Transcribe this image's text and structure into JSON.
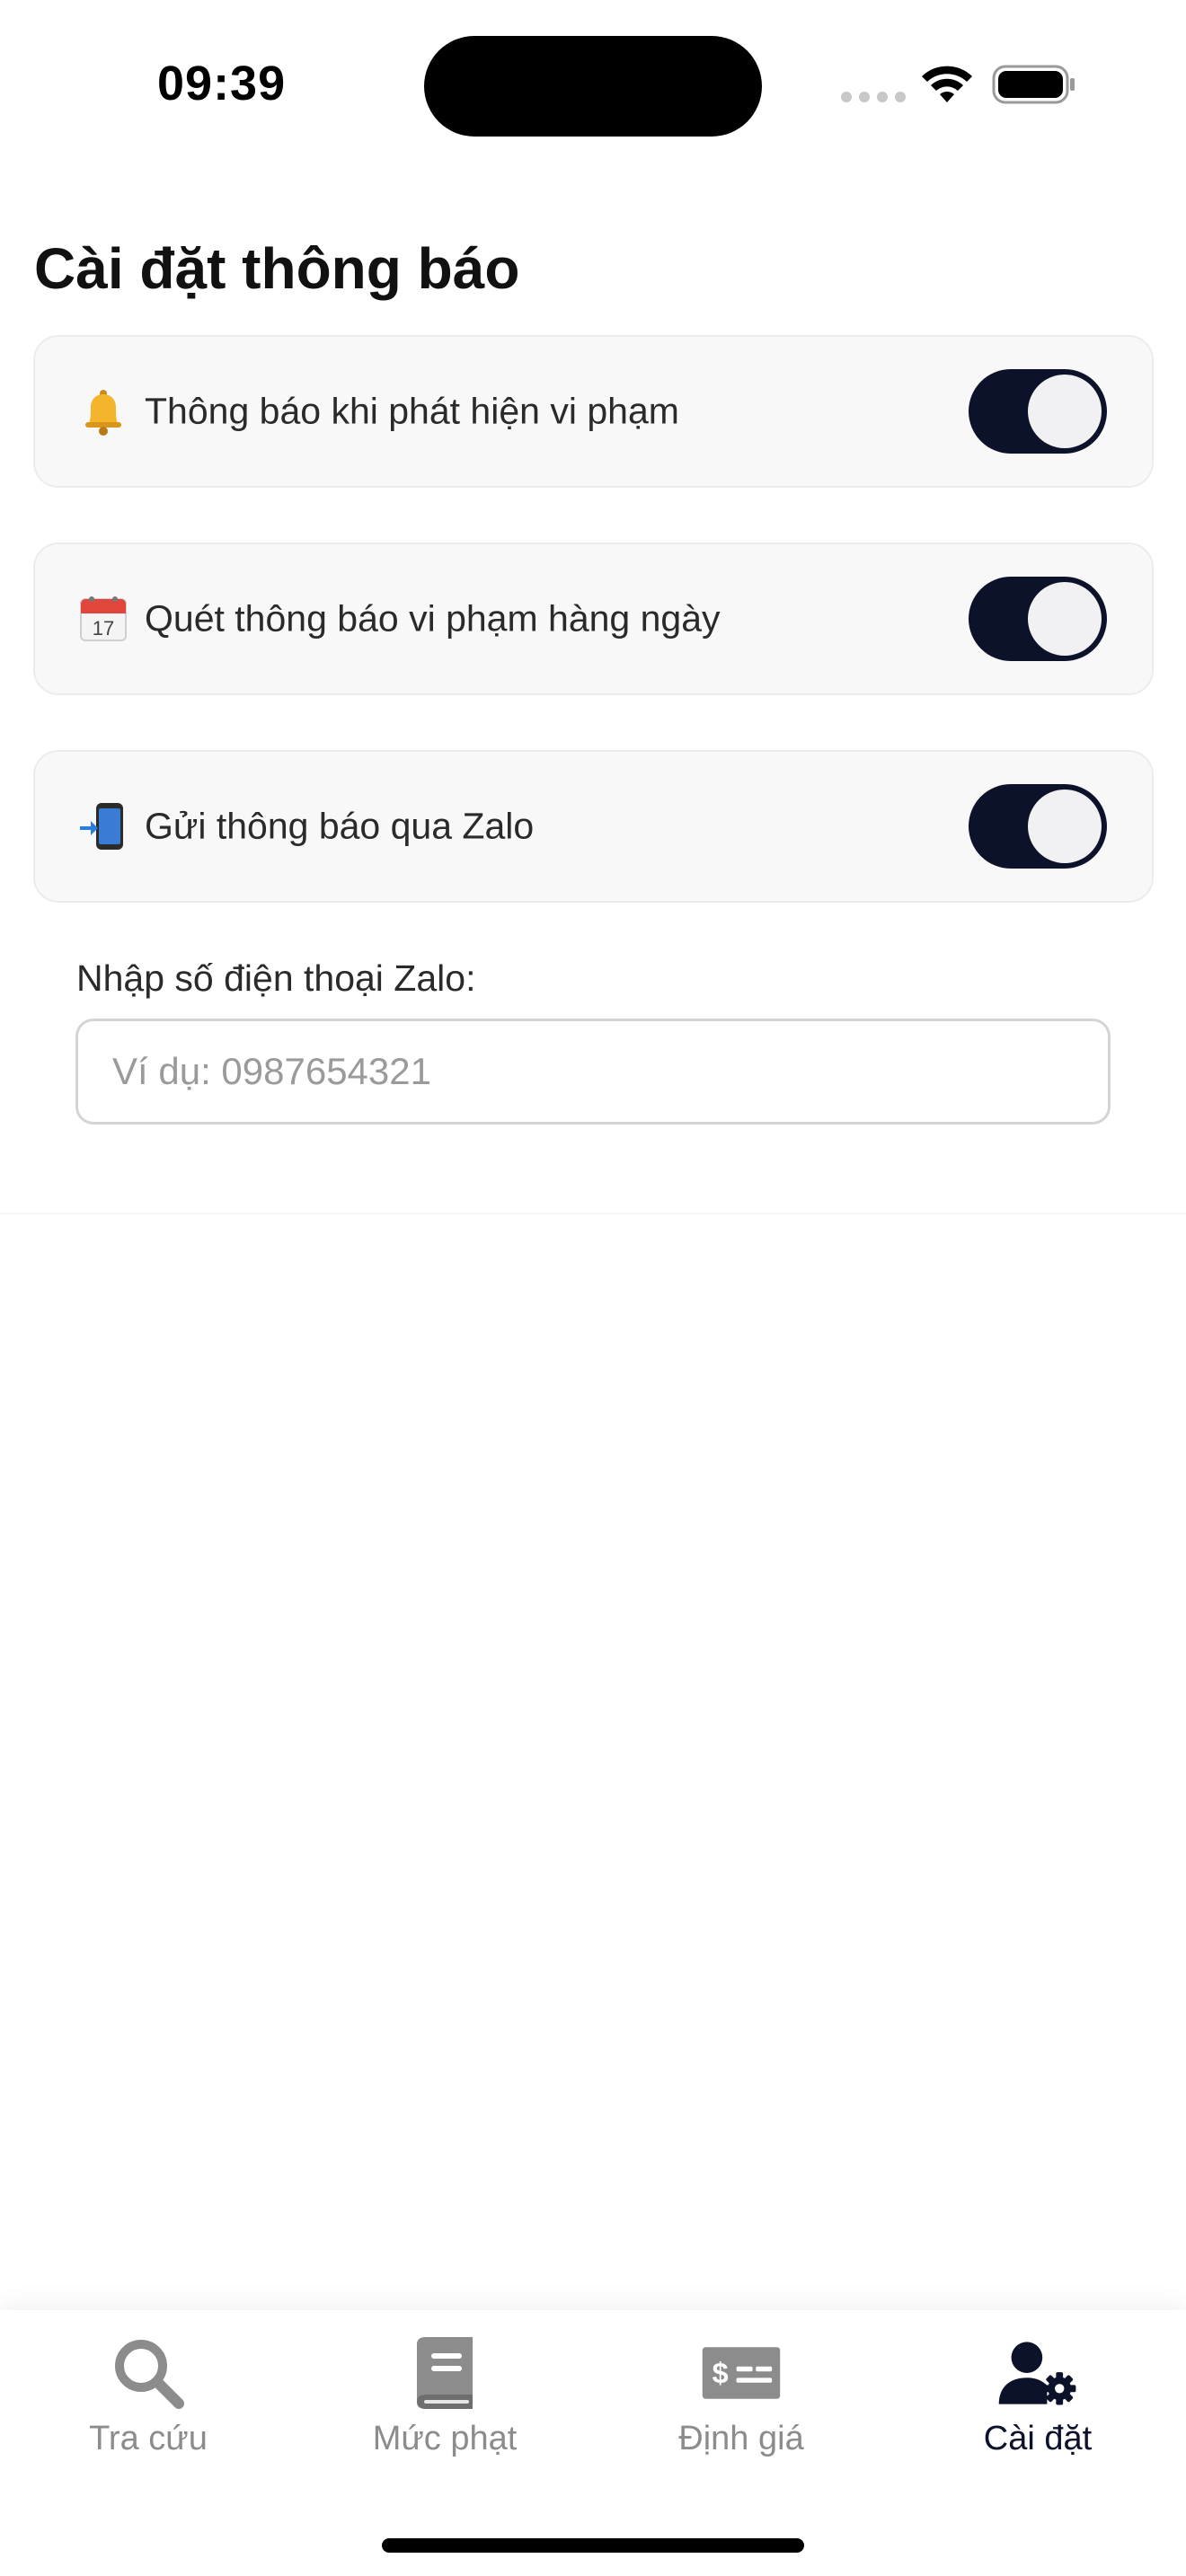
{
  "status_bar": {
    "time": "09:39"
  },
  "page": {
    "title": "Cài đặt thông báo"
  },
  "settings": [
    {
      "icon": "bell-emoji-icon",
      "label": "Thông báo khi phát hiện vi phạm",
      "enabled": true
    },
    {
      "icon": "calendar-emoji-icon",
      "label": "Quét thông báo vi phạm hàng ngày",
      "enabled": true
    },
    {
      "icon": "phone-arrow-emoji-icon",
      "label": "Gửi thông báo qua Zalo",
      "enabled": true
    }
  ],
  "zalo_phone": {
    "label": "Nhập số điện thoại Zalo:",
    "placeholder": "Ví dụ: 0987654321",
    "value": ""
  },
  "tabs": [
    {
      "icon": "search-icon",
      "label": "Tra cứu",
      "active": false
    },
    {
      "icon": "book-icon",
      "label": "Mức phạt",
      "active": false
    },
    {
      "icon": "money-bill-icon",
      "label": "Định giá",
      "active": false
    },
    {
      "icon": "user-gear-icon",
      "label": "Cài đặt",
      "active": true
    }
  ],
  "colors": {
    "toggle_on": "#0b1229",
    "tab_active": "#0b1229",
    "tab_inactive": "#8c8c8c"
  }
}
